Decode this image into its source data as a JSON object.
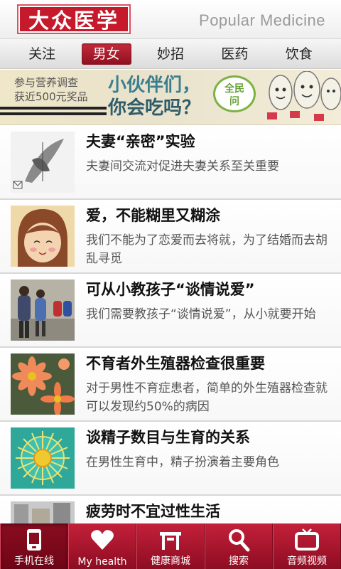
{
  "header": {
    "logo_text": "大众医学",
    "subtitle": "Popular Medicine"
  },
  "categories": [
    {
      "label": "关注",
      "active": false
    },
    {
      "label": "男女",
      "active": true
    },
    {
      "label": "妙招",
      "active": false
    },
    {
      "label": "医药",
      "active": false
    },
    {
      "label": "饮食",
      "active": false
    }
  ],
  "banner": {
    "survey_line1": "参与营养调查",
    "survey_line2": "获近500元奖品",
    "headline_line1": "小伙伴们，",
    "headline_line2": "你会吃吗？",
    "badge_line1": "全民",
    "badge_line2": "问",
    "accent_color": "#3a7f8f"
  },
  "articles": [
    {
      "title": "夫妻“亲密”实验",
      "desc": "夫妻间交流对促进夫妻关系至关重要"
    },
    {
      "title": "爱，不能糊里又糊涂",
      "desc": "我们不能为了恋爱而去将就，为了结婚而去胡乱寻觅"
    },
    {
      "title": "可从小教孩子“谈情说爱”",
      "desc": "我们需要教孩子“谈情说爱”，从小就要开始"
    },
    {
      "title": "不育者外生殖器检查很重要",
      "desc": "对于男性不育症患者，简单的外生殖器检查就可以发现约50%的病因"
    },
    {
      "title": "谈精子数目与生育的关系",
      "desc": "在男性生育中，精子扮演着主要角色"
    },
    {
      "title": "疲劳时不宜过性生活",
      "desc": ""
    }
  ],
  "bottom_tabs": [
    {
      "label": "手机在线",
      "icon": "phone-icon",
      "active": true
    },
    {
      "label": "My health",
      "icon": "heart-icon",
      "active": false
    },
    {
      "label": "健康商城",
      "icon": "shop-icon",
      "active": false
    },
    {
      "label": "搜索",
      "icon": "search-icon",
      "active": false
    },
    {
      "label": "音频视频",
      "icon": "tv-icon",
      "active": false
    }
  ],
  "colors": {
    "brand_red": "#c41a2b",
    "tab_bar": "#a8142d"
  }
}
